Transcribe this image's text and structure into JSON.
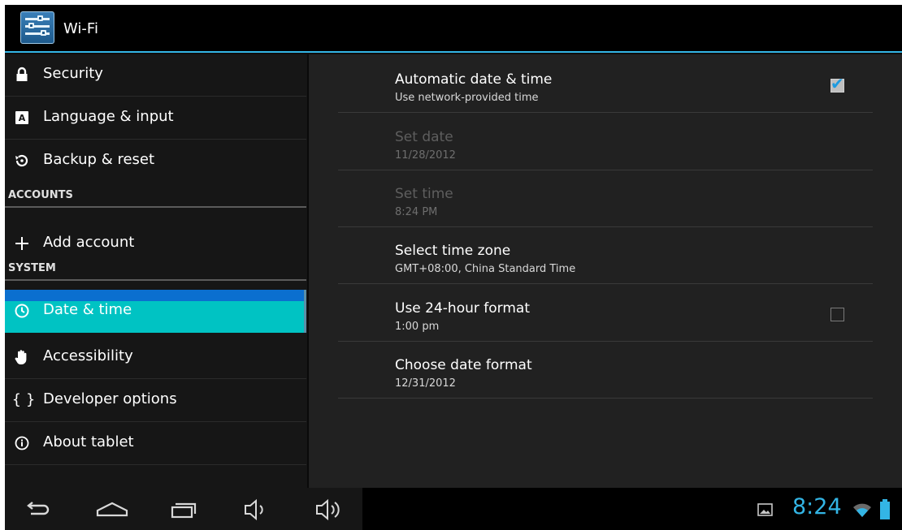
{
  "action_bar": {
    "title": "Wi-Fi",
    "accent_color": "#33b5e5",
    "icon": "settings-sliders-icon"
  },
  "sidebar": {
    "items": [
      {
        "label": "Security",
        "icon": "lock-icon"
      },
      {
        "label": "Language & input",
        "icon": "keyboard-icon"
      },
      {
        "label": "Backup & reset",
        "icon": "backup-icon"
      },
      {
        "label": "Add account",
        "icon": "plus-icon"
      },
      {
        "label": "Date & time",
        "icon": "clock-icon",
        "selected": true
      },
      {
        "label": "Accessibility",
        "icon": "hand-icon"
      },
      {
        "label": "Developer options",
        "icon": "braces-icon"
      },
      {
        "label": "About tablet",
        "icon": "info-icon"
      }
    ],
    "sections": {
      "accounts": "ACCOUNTS",
      "system": "SYSTEM"
    },
    "selected_color": "#00c3c3"
  },
  "settings": [
    {
      "title": "Automatic date & time",
      "summary": "Use network-provided time",
      "checkbox": true,
      "checked": true,
      "enabled": true
    },
    {
      "title": "Set date",
      "summary": "11/28/2012",
      "checkbox": false,
      "enabled": false
    },
    {
      "title": "Set time",
      "summary": "8:24 PM",
      "checkbox": false,
      "enabled": false
    },
    {
      "title": "Select time zone",
      "summary": "GMT+08:00, China Standard Time",
      "checkbox": false,
      "enabled": true
    },
    {
      "title": "Use 24-hour format",
      "summary": "1:00 pm",
      "checkbox": true,
      "checked": false,
      "enabled": true
    },
    {
      "title": "Choose date format",
      "summary": "12/31/2012",
      "checkbox": false,
      "enabled": true
    }
  ],
  "system_bar": {
    "buttons": [
      "back-icon",
      "home-icon",
      "recent-apps-icon",
      "volume-down-icon",
      "volume-up-icon"
    ],
    "clock": "8:24",
    "status_icons": [
      "screenshot-notification-icon",
      "wifi-icon",
      "battery-icon"
    ],
    "clock_color": "#33b5e5"
  }
}
